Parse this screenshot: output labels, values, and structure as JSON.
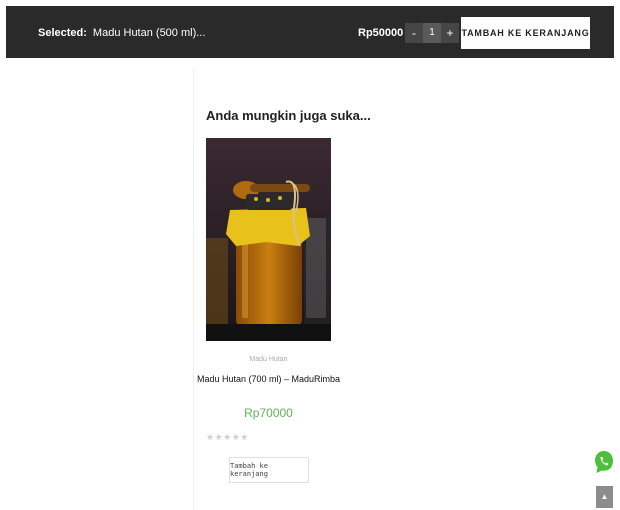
{
  "top_bar": {
    "selected_label": "Selected:",
    "selected_value": "Madu Hutan (500 ml)...",
    "price": "Rp50000",
    "qty_minus": "-",
    "qty_value": "1",
    "qty_plus": "+",
    "add_to_cart": "TAMBAH KE KERANJANG"
  },
  "related": {
    "heading": "Anda mungkin juga suka...",
    "product": {
      "category": "Madu Hutan",
      "name": "Madu Hutan (700 ml) – MaduRimba",
      "price": "Rp70000",
      "rating_stars": "★★★★★",
      "add_to_cart": "Tambah ke keranjang"
    }
  },
  "floating": {
    "whatsapp_icon": "whatsapp-icon",
    "scroll_top_icon": "chevron-up-icon",
    "scroll_top_glyph": "▲"
  },
  "colors": {
    "top_bar_bg": "#2a2a2a",
    "price_green": "#5fb45c",
    "whatsapp_green": "#4cbf3c"
  }
}
